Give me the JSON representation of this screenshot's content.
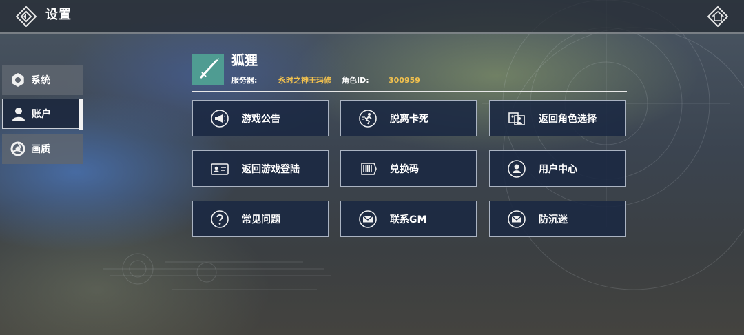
{
  "header": {
    "title": "设置",
    "back_icon": "diamond-back-icon",
    "home_icon": "home-icon"
  },
  "sidebar": {
    "active_index": 1,
    "items": [
      {
        "label": "系统",
        "icon": "gear-icon"
      },
      {
        "label": "账户",
        "icon": "user-icon"
      },
      {
        "label": "画质",
        "icon": "aperture-icon"
      }
    ]
  },
  "profile": {
    "name": "狐狸",
    "avatar_color": "#4f9c92",
    "server_label": "服务器:",
    "server_value": "永时之神王玛修",
    "role_id_label": "角色ID:",
    "role_id_value": "300959"
  },
  "actions": [
    {
      "label": "游戏公告",
      "icon": "megaphone-icon"
    },
    {
      "label": "脱离卡死",
      "icon": "escape-run-icon"
    },
    {
      "label": "返回角色选择",
      "icon": "character-select-icon"
    },
    {
      "label": "返回游戏登陆",
      "icon": "id-card-icon"
    },
    {
      "label": "兑换码",
      "icon": "barcode-icon"
    },
    {
      "label": "用户中心",
      "icon": "user-circle-icon"
    },
    {
      "label": "常见问题",
      "icon": "question-icon"
    },
    {
      "label": "联系GM",
      "icon": "mail-icon"
    },
    {
      "label": "防沉迷",
      "icon": "mail-icon"
    }
  ],
  "colors": {
    "accent_gold": "#f2c14e",
    "button_bg": "#1a2842",
    "button_border": "#aab3c2"
  }
}
